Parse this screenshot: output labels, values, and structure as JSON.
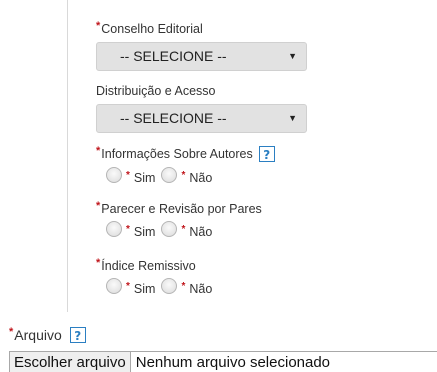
{
  "form": {
    "required_mark": "*",
    "help_icon_glyph": "?",
    "select_caret": "▼",
    "conselho": {
      "label": "Conselho Editorial",
      "select_value": "-- SELECIONE --"
    },
    "distribuicao": {
      "label": "Distribuição e Acesso",
      "select_value": "-- SELECIONE --"
    },
    "informacoes": {
      "label": "Informações Sobre Autores",
      "options": [
        "Sim",
        "Não"
      ]
    },
    "parecer": {
      "label": "Parecer e Revisão por Pares",
      "options": [
        "Sim",
        "Não"
      ]
    },
    "indice": {
      "label": "Índice Remissivo",
      "options": [
        "Sim",
        "Não"
      ]
    },
    "arquivo": {
      "label": "Arquivo",
      "button_label": "Escolher arquivo",
      "status": "Nenhum arquivo selecionado"
    }
  },
  "colors": {
    "required": "#c0151b",
    "help": "#2b7fc2",
    "select_bg": "#e2e2e2"
  }
}
